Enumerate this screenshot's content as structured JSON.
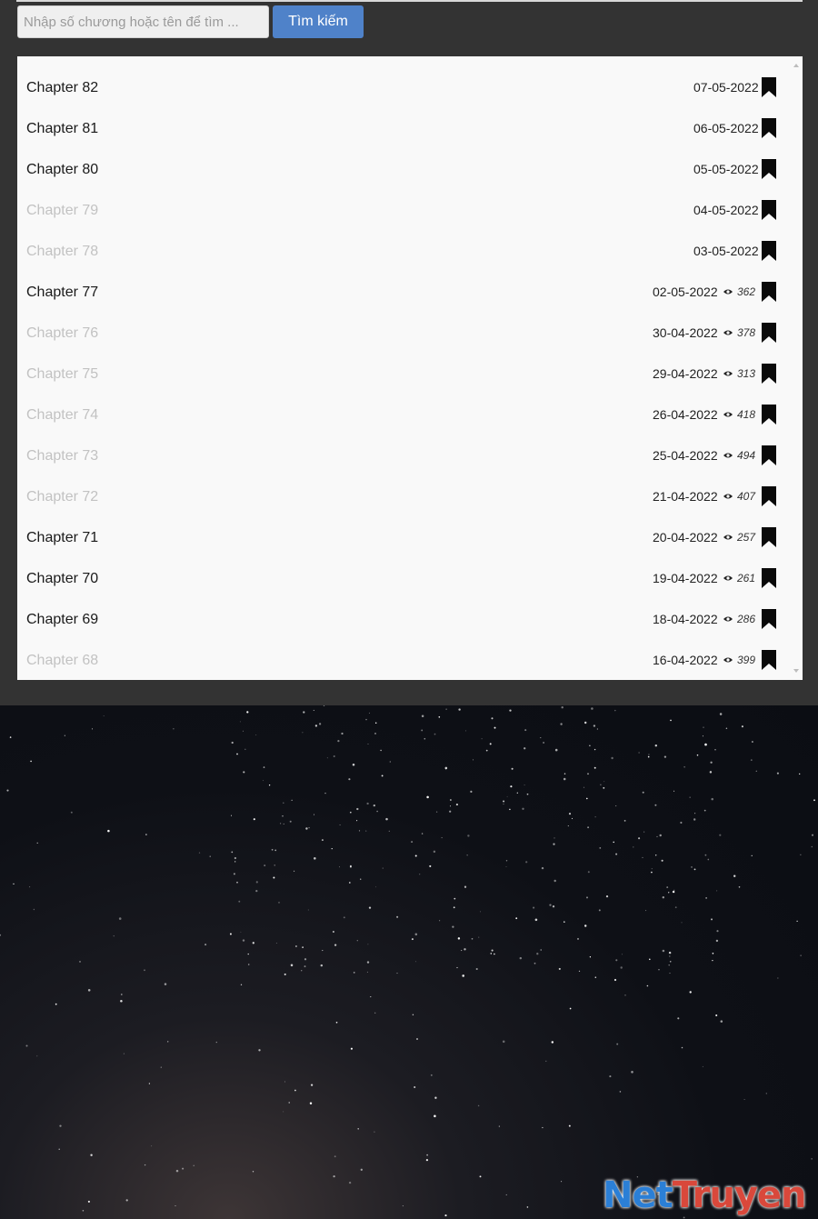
{
  "search": {
    "placeholder": "Nhập số chương hoặc tên để tìm ...",
    "button_label": "Tìm kiếm"
  },
  "chapters": [
    {
      "name": "Chapter 82",
      "date": "07-05-2022",
      "views": null,
      "faded": false
    },
    {
      "name": "Chapter 81",
      "date": "06-05-2022",
      "views": null,
      "faded": false
    },
    {
      "name": "Chapter 80",
      "date": "05-05-2022",
      "views": null,
      "faded": false
    },
    {
      "name": "Chapter 79",
      "date": "04-05-2022",
      "views": null,
      "faded": true
    },
    {
      "name": "Chapter 78",
      "date": "03-05-2022",
      "views": null,
      "faded": true
    },
    {
      "name": "Chapter 77",
      "date": "02-05-2022",
      "views": "362",
      "faded": false
    },
    {
      "name": "Chapter 76",
      "date": "30-04-2022",
      "views": "378",
      "faded": true
    },
    {
      "name": "Chapter 75",
      "date": "29-04-2022",
      "views": "313",
      "faded": true
    },
    {
      "name": "Chapter 74",
      "date": "26-04-2022",
      "views": "418",
      "faded": true
    },
    {
      "name": "Chapter 73",
      "date": "25-04-2022",
      "views": "494",
      "faded": true
    },
    {
      "name": "Chapter 72",
      "date": "21-04-2022",
      "views": "407",
      "faded": true
    },
    {
      "name": "Chapter 71",
      "date": "20-04-2022",
      "views": "257",
      "faded": false
    },
    {
      "name": "Chapter 70",
      "date": "19-04-2022",
      "views": "261",
      "faded": false
    },
    {
      "name": "Chapter 69",
      "date": "18-04-2022",
      "views": "286",
      "faded": false
    },
    {
      "name": "Chapter 68",
      "date": "16-04-2022",
      "views": "399",
      "faded": true
    }
  ],
  "icons": {
    "view": "eye-icon",
    "follow": "bookmark-icon"
  },
  "watermark": {
    "part1": "Net",
    "part2": "Truyen"
  }
}
